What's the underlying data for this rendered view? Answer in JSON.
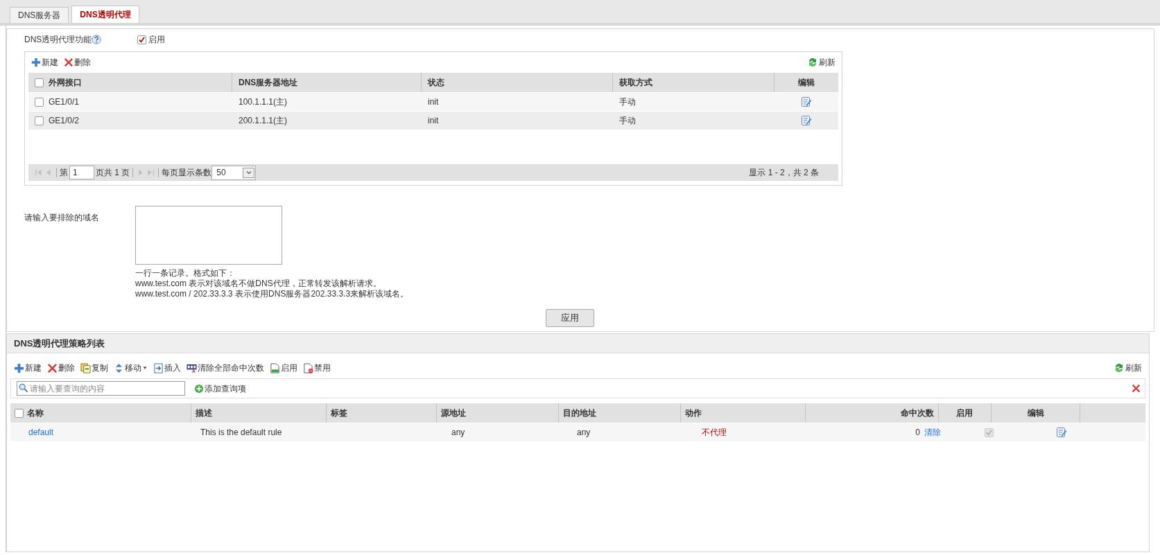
{
  "tabs": [
    {
      "label": "DNS服务器",
      "selected": false
    },
    {
      "label": "DNS透明代理",
      "selected": true
    }
  ],
  "proxy_function": {
    "label": "DNS透明代理功能",
    "enable_label": "启用",
    "checked": true
  },
  "interface_table": {
    "toolbar": [
      {
        "kind": "add",
        "label": "新建"
      },
      {
        "kind": "delete",
        "label": "删除"
      }
    ],
    "refresh": "刷新",
    "all_checked": false,
    "columns": [
      "外网接口",
      "DNS服务器地址",
      "状态",
      "获取方式",
      "编辑"
    ],
    "rows": [
      {
        "checked": false,
        "cells": [
          "GE1/0/1",
          "100.1.1.1(主)",
          "init",
          "手动"
        ]
      },
      {
        "checked": false,
        "cells": [
          "GE1/0/2",
          "200.1.1.1(主)",
          "init",
          "手动"
        ]
      }
    ],
    "pagination": {
      "page_prefix": "第",
      "page": "1",
      "page_suffix": "页共 1 页",
      "per_page_label": "每页显示条数",
      "per_page": "50",
      "summary": "显示 1 - 2，共 2 条"
    }
  },
  "exclude": {
    "label": "请输入要排除的域名",
    "hint_lines": [
      "一行一条记录。格式如下：",
      "www.test.com 表示对该域名不做DNS代理，正常转发该解析请求。",
      "www.test.com / 202.33.3.3 表示使用DNS服务器202.33.3.3来解析该域名。"
    ],
    "apply": "应用"
  },
  "policy_list": {
    "title": "DNS透明代理策略列表",
    "toolbar": [
      {
        "kind": "add",
        "label": "新建"
      },
      {
        "kind": "delete",
        "label": "删除"
      },
      {
        "kind": "copy",
        "label": "复制"
      },
      {
        "kind": "move",
        "label": "移动"
      },
      {
        "kind": "insert",
        "label": "插入"
      },
      {
        "kind": "clear",
        "label": "清除全部命中次数"
      },
      {
        "kind": "enable",
        "label": "启用"
      },
      {
        "kind": "disable",
        "label": "禁用"
      }
    ],
    "refresh": "刷新",
    "search_placeholder": "请输入要查询的内容",
    "add_query": "添加查询项",
    "all_checked": false,
    "columns": [
      "名称",
      "描述",
      "标签",
      "源地址",
      "目的地址",
      "动作",
      "命中次数",
      "启用",
      "编辑"
    ],
    "rows": [
      {
        "name": "default",
        "description": "This is the default rule",
        "source": "any",
        "destination": "any",
        "action": "不代理",
        "hits": "0",
        "clear": "清除",
        "enabled": true
      }
    ]
  }
}
